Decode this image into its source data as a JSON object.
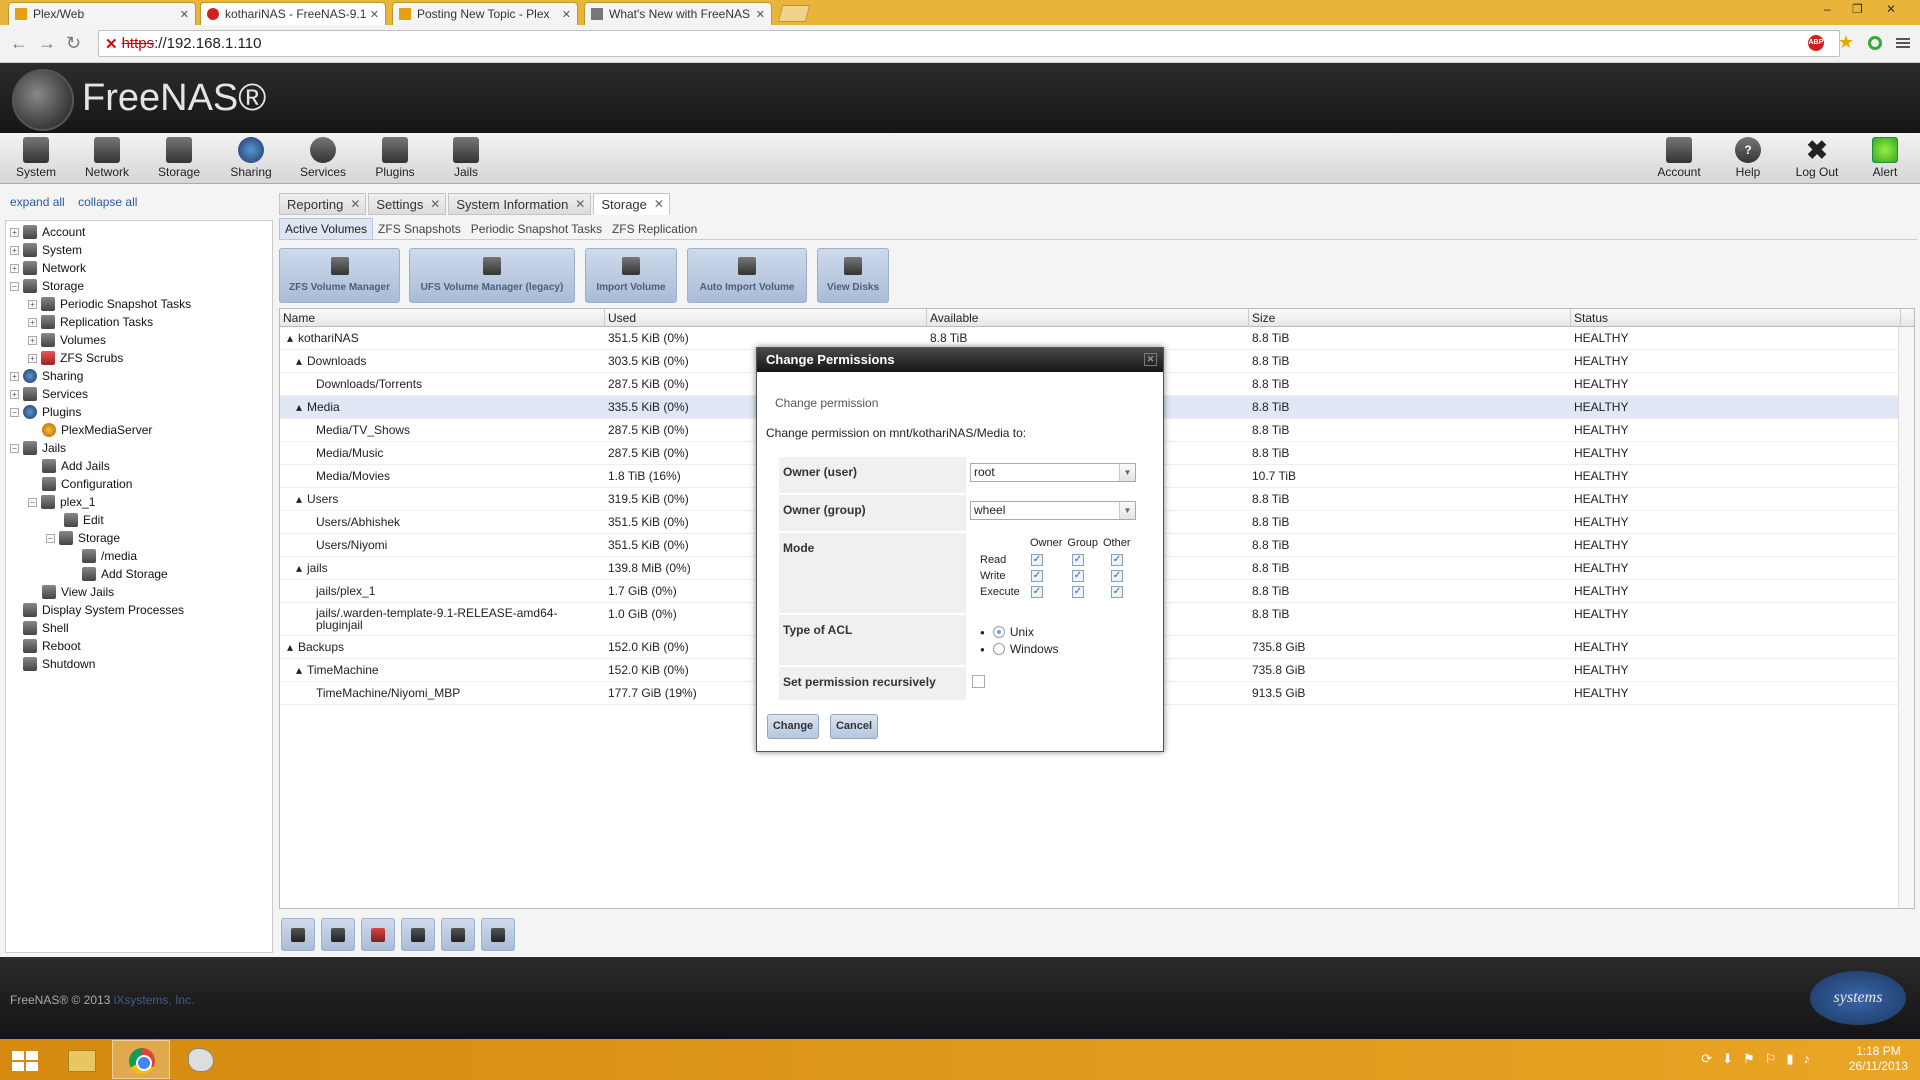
{
  "browser": {
    "tabs": [
      {
        "title": "Plex/Web"
      },
      {
        "title": "kothariNAS - FreeNAS-9.1"
      },
      {
        "title": "Posting New Topic - Plex"
      },
      {
        "title": "What's New with FreeNAS"
      }
    ],
    "url_scheme": "https",
    "url_rest": "://192.168.1.110",
    "win_controls": [
      "–",
      "❐",
      "✕"
    ]
  },
  "app": {
    "logo_text": "FreeNAS®",
    "toolbar": [
      "System",
      "Network",
      "Storage",
      "Sharing",
      "Services",
      "Plugins",
      "Jails"
    ],
    "toolbar_right": [
      "Account",
      "Help",
      "Log Out",
      "Alert"
    ]
  },
  "tree": {
    "expand_all": "expand all",
    "collapse_all": "collapse all",
    "nodes": [
      "Account",
      "System",
      "Network",
      "Storage",
      "Periodic Snapshot Tasks",
      "Replication Tasks",
      "Volumes",
      "ZFS Scrubs",
      "Sharing",
      "Services",
      "Plugins",
      "PlexMediaServer",
      "Jails",
      "Add Jails",
      "Configuration",
      "plex_1",
      "Edit",
      "Storage",
      "/media",
      "Add Storage",
      "View Jails",
      "Display System Processes",
      "Shell",
      "Reboot",
      "Shutdown"
    ]
  },
  "content": {
    "tabs": [
      "Reporting",
      "Settings",
      "System Information",
      "Storage"
    ],
    "subtabs": [
      "Active Volumes",
      "ZFS Snapshots",
      "Periodic Snapshot Tasks",
      "ZFS Replication"
    ],
    "actions": [
      "ZFS Volume Manager",
      "UFS Volume Manager (legacy)",
      "Import Volume",
      "Auto Import Volume",
      "View Disks"
    ],
    "columns": [
      "Name",
      "Used",
      "Available",
      "Size",
      "Status"
    ],
    "rows": [
      {
        "name": "kothariNAS",
        "used": "351.5 KiB (0%)",
        "avail": "8.8 TiB",
        "size": "8.8 TiB",
        "status": "HEALTHY"
      },
      {
        "name": "Downloads",
        "used": "303.5 KiB (0%)",
        "avail": "",
        "size": "8.8 TiB",
        "status": "HEALTHY"
      },
      {
        "name": "Downloads/Torrents",
        "used": "287.5 KiB (0%)",
        "avail": "",
        "size": "8.8 TiB",
        "status": "HEALTHY"
      },
      {
        "name": "Media",
        "used": "335.5 KiB (0%)",
        "avail": "",
        "size": "8.8 TiB",
        "status": "HEALTHY"
      },
      {
        "name": "Media/TV_Shows",
        "used": "287.5 KiB (0%)",
        "avail": "",
        "size": "8.8 TiB",
        "status": "HEALTHY"
      },
      {
        "name": "Media/Music",
        "used": "287.5 KiB (0%)",
        "avail": "",
        "size": "8.8 TiB",
        "status": "HEALTHY"
      },
      {
        "name": "Media/Movies",
        "used": "1.8 TiB (16%)",
        "avail": "",
        "size": "10.7 TiB",
        "status": "HEALTHY"
      },
      {
        "name": "Users",
        "used": "319.5 KiB (0%)",
        "avail": "",
        "size": "8.8 TiB",
        "status": "HEALTHY"
      },
      {
        "name": "Users/Abhishek",
        "used": "351.5 KiB (0%)",
        "avail": "",
        "size": "8.8 TiB",
        "status": "HEALTHY"
      },
      {
        "name": "Users/Niyomi",
        "used": "351.5 KiB (0%)",
        "avail": "",
        "size": "8.8 TiB",
        "status": "HEALTHY"
      },
      {
        "name": "jails",
        "used": "139.8 MiB (0%)",
        "avail": "",
        "size": "8.8 TiB",
        "status": "HEALTHY"
      },
      {
        "name": "jails/plex_1",
        "used": "1.7 GiB (0%)",
        "avail": "",
        "size": "8.8 TiB",
        "status": "HEALTHY"
      },
      {
        "name": "jails/.warden-template-9.1-RELEASE-amd64-pluginjail",
        "used": "1.0 GiB (0%)",
        "avail": "",
        "size": "8.8 TiB",
        "status": "HEALTHY"
      },
      {
        "name": "Backups",
        "used": "152.0 KiB (0%)",
        "avail": "",
        "size": "735.8 GiB",
        "status": "HEALTHY"
      },
      {
        "name": "TimeMachine",
        "used": "152.0 KiB (0%)",
        "avail": "",
        "size": "735.8 GiB",
        "status": "HEALTHY"
      },
      {
        "name": "TimeMachine/Niyomi_MBP",
        "used": "177.7 GiB (19%)",
        "avail": "",
        "size": "913.5 GiB",
        "status": "HEALTHY"
      }
    ]
  },
  "dialog": {
    "title": "Change Permissions",
    "subtitle": "Change permission",
    "description": "Change permission on mnt/kothariNAS/Media to:",
    "owner_user_label": "Owner (user)",
    "owner_user_value": "root",
    "owner_group_label": "Owner (group)",
    "owner_group_value": "wheel",
    "mode_label": "Mode",
    "mode_cols": [
      "Owner",
      "Group",
      "Other"
    ],
    "mode_rows": [
      "Read",
      "Write",
      "Execute"
    ],
    "acl_label": "Type of ACL",
    "acl_options": [
      "Unix",
      "Windows"
    ],
    "acl_selected": "Unix",
    "recursive_label": "Set permission recursively",
    "recursive_checked": false,
    "change_button": "Change",
    "cancel_button": "Cancel"
  },
  "footer": {
    "copyright": "FreeNAS® © 2013",
    "company_link": "iXsystems, Inc.",
    "logo_text": "systems"
  },
  "taskbar": {
    "time": "1:18 PM",
    "date": "26/11/2013"
  }
}
